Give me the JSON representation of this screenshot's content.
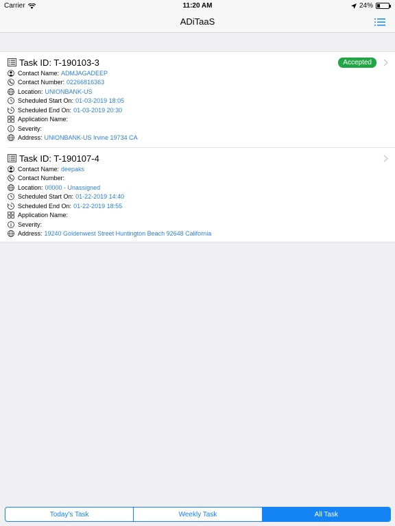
{
  "status_bar": {
    "carrier": "Carrier",
    "time": "11:20 AM",
    "battery": "24%",
    "battery_level": 0.24
  },
  "nav": {
    "title": "ADiTaaS"
  },
  "tasks": [
    {
      "id_label": "Task ID: T-190103-3",
      "status": "Accepted",
      "contact_name_label": "Contact Name:",
      "contact_name": "ADMJAGADEEP",
      "contact_number_label": "Contact Number:",
      "contact_number": "02266816363",
      "location_label": "Location:",
      "location": "UNIONBANK-US",
      "start_label": "Scheduled Start On:",
      "start": "01-03-2019 18:05",
      "end_label": "Scheduled End On:",
      "end": "01-03-2019 20:30",
      "app_label": "Application Name:",
      "app": "",
      "severity_label": "Severity:",
      "severity": "",
      "address_label": "Address:",
      "address": "UNIONBANK-US Irvine 19734 CA"
    },
    {
      "id_label": "Task ID: T-190107-4",
      "status": "",
      "contact_name_label": "Contact Name:",
      "contact_name": "deepaks",
      "contact_number_label": "Contact Number:",
      "contact_number": "",
      "location_label": "Location:",
      "location": "00000 - Unassigned",
      "start_label": "Scheduled Start On:",
      "start": "01-22-2019 14:40",
      "end_label": "Scheduled End On:",
      "end": "01-22-2019 18:55",
      "app_label": "Application Name:",
      "app": "",
      "severity_label": "Severity:",
      "severity": "",
      "address_label": "Address:",
      "address": "19240 Goldenwest Street Huntington Beach 92648 California"
    }
  ],
  "tabs": [
    {
      "label": "Today's Task",
      "active": false
    },
    {
      "label": "Weekly Task",
      "active": false
    },
    {
      "label": "All Task",
      "active": true
    }
  ],
  "colors": {
    "accent": "#1484f4",
    "value_blue": "#2a7fd4",
    "accepted_green": "#22a645"
  },
  "icons": [
    "wifi-icon",
    "location-arrow-icon",
    "battery-icon",
    "menu-list-icon",
    "task-list-icon",
    "person-icon",
    "phone-icon",
    "globe-icon",
    "clock-icon",
    "clock-end-icon",
    "grid-icon",
    "info-icon",
    "chevron-right-icon"
  ]
}
